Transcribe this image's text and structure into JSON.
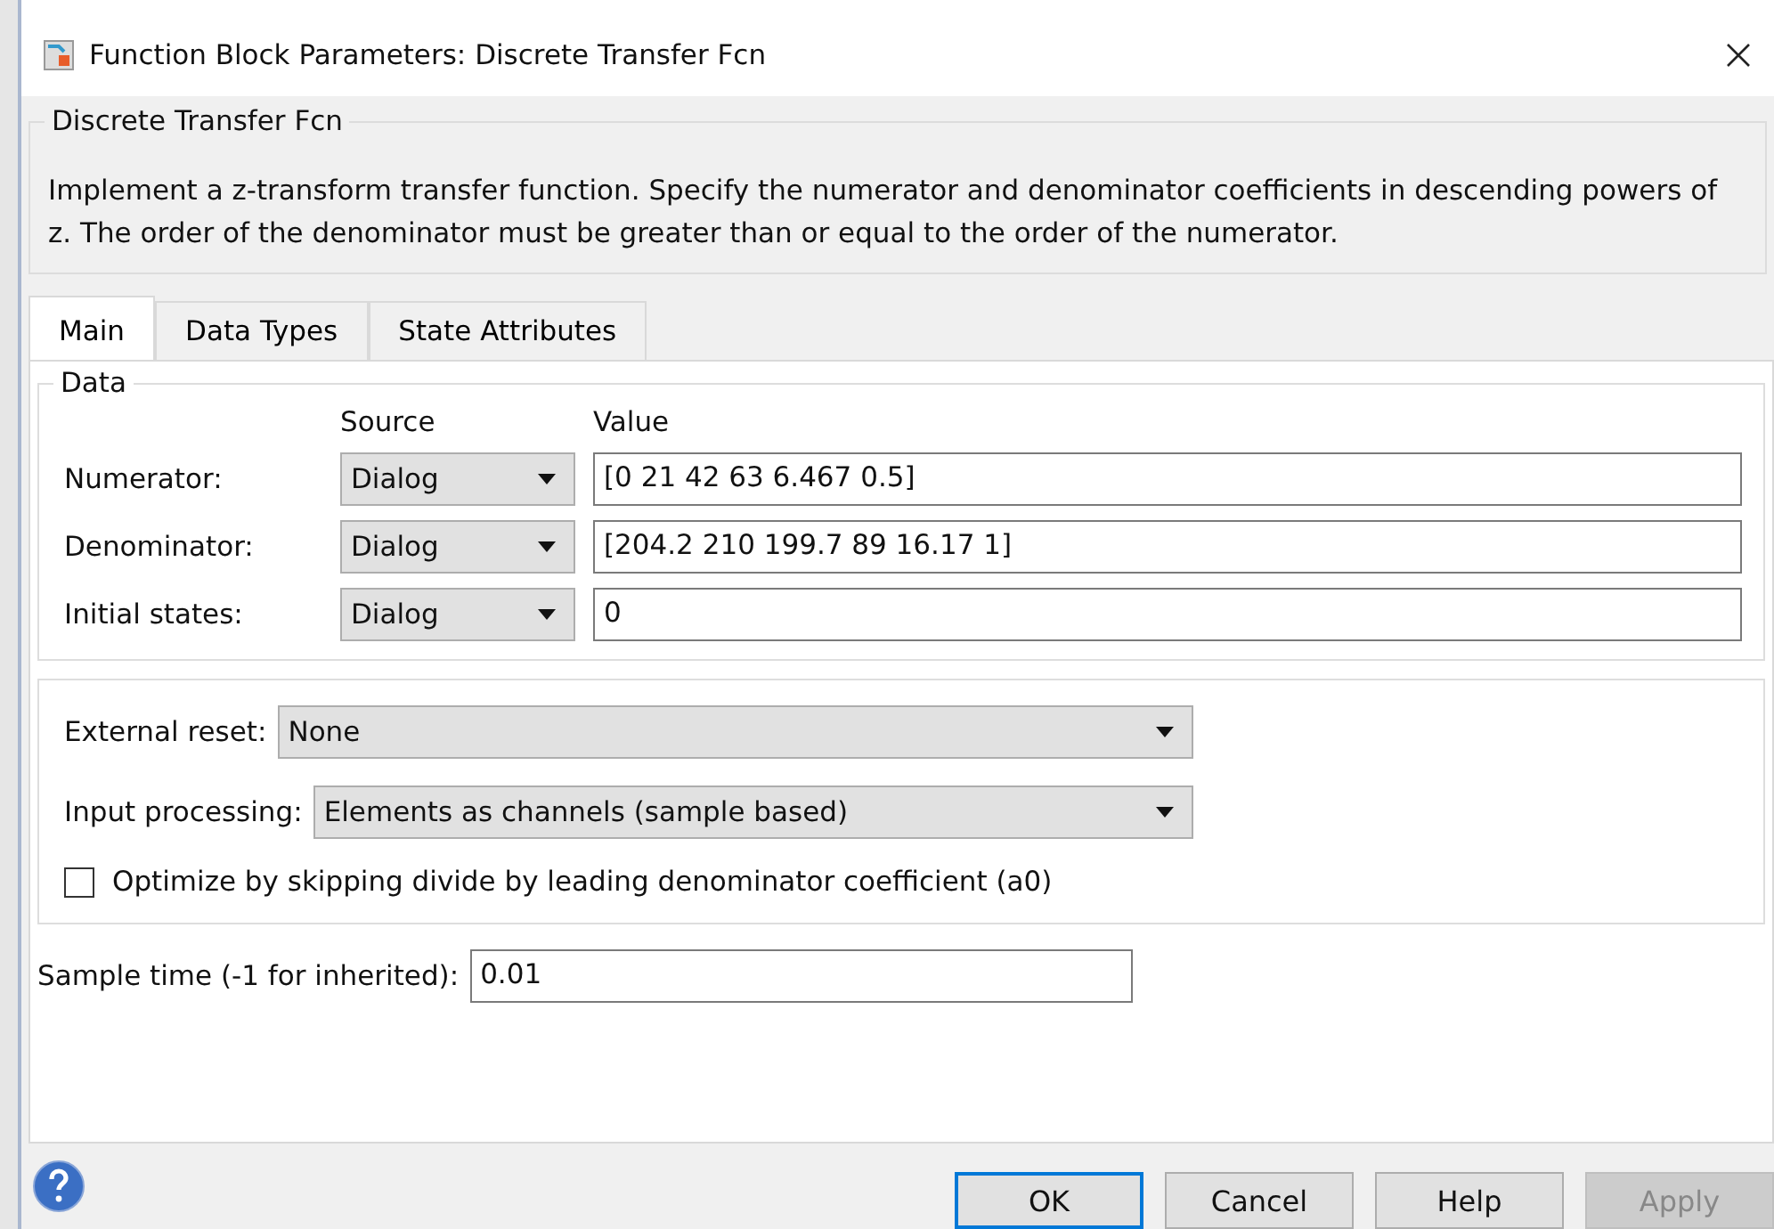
{
  "window": {
    "title": "Function Block Parameters: Discrete Transfer Fcn"
  },
  "description": {
    "title": "Discrete Transfer Fcn",
    "text": "Implement a z-transform transfer function. Specify the numerator and denominator coefficients in descending powers of z. The order of the denominator must be greater than or equal to the order of the numerator."
  },
  "tabs": [
    {
      "label": "Main",
      "selected": true
    },
    {
      "label": "Data Types",
      "selected": false
    },
    {
      "label": "State Attributes",
      "selected": false
    }
  ],
  "data_group": {
    "title": "Data",
    "source_header": "Source",
    "value_header": "Value",
    "rows": [
      {
        "label": "Numerator:",
        "source": "Dialog",
        "value": "[0 21 42 63 6.467 0.5]"
      },
      {
        "label": "Denominator:",
        "source": "Dialog",
        "value": "[204.2 210 199.7 89 16.17 1]"
      },
      {
        "label": "Initial states:",
        "source": "Dialog",
        "value": "0"
      }
    ]
  },
  "options": [
    {
      "kind": "dropdown",
      "label": "External reset:",
      "value": "None"
    },
    {
      "kind": "dropdown",
      "label": "Input processing:",
      "value": "Elements as channels (sample based)"
    },
    {
      "kind": "checkbox",
      "label": "Optimize by skipping divide by leading denominator coefficient (a0)",
      "checked": false
    }
  ],
  "sample_time": {
    "label": "Sample time (-1 for inherited):",
    "value": "0.01"
  },
  "buttons": [
    {
      "label": "OK",
      "default": true,
      "disabled": false
    },
    {
      "label": "Cancel",
      "default": false,
      "disabled": false
    },
    {
      "label": "Help",
      "default": false,
      "disabled": false
    },
    {
      "label": "Apply",
      "default": false,
      "disabled": true
    }
  ]
}
